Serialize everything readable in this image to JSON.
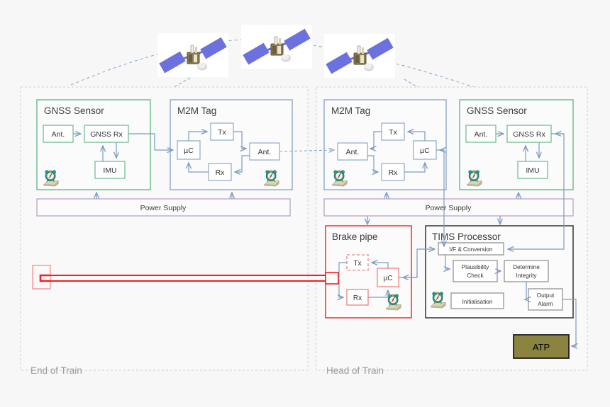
{
  "diagram": {
    "title": "Train Integrity Monitoring System (TIMS) architecture",
    "colors": {
      "background": "#f7f7f7",
      "container_border": "#cccccc",
      "gnss_green": "#66bb8a",
      "m2m_blue": "#8fa9c9",
      "power_purple": "#b49cc4",
      "brake_red": "#f22020",
      "tims_black": "#333333",
      "atp_olive": "#8b8340",
      "arrow_blue": "#7d9bc1",
      "dashed_link": "#8fa9c9",
      "text_dark": "#404040",
      "text_muted": "#9a9a9a"
    },
    "sections": [
      {
        "id": "eot",
        "label": "End of Train"
      },
      {
        "id": "hot",
        "label": "Head of Train"
      }
    ],
    "satellites": [
      {
        "id": "sat-1",
        "name": "gnss-satellite-icon"
      },
      {
        "id": "sat-2",
        "name": "gnss-satellite-icon"
      },
      {
        "id": "sat-3",
        "name": "gnss-satellite-icon"
      }
    ],
    "eot": {
      "gnss_sensor": {
        "title": "GNSS Sensor",
        "blocks": [
          {
            "id": "ant",
            "label": "Ant."
          },
          {
            "id": "gnss_rx",
            "label": "GNSS Rx"
          },
          {
            "id": "imu",
            "label": "IMU"
          }
        ],
        "clock_icon": "alarm-clock-icon"
      },
      "m2m_tag": {
        "title": "M2M Tag",
        "blocks": [
          {
            "id": "uc",
            "label": "µC"
          },
          {
            "id": "tx",
            "label": "Tx"
          },
          {
            "id": "rx",
            "label": "Rx"
          },
          {
            "id": "ant",
            "label": "Ant."
          }
        ],
        "clock_icon": "alarm-clock-icon"
      },
      "power_supply": {
        "label": "Power Supply"
      },
      "brake_pipe_terminus": {
        "label": ""
      }
    },
    "hot": {
      "m2m_tag": {
        "title": "M2M Tag",
        "blocks": [
          {
            "id": "ant",
            "label": "Ant."
          },
          {
            "id": "tx",
            "label": "Tx"
          },
          {
            "id": "rx",
            "label": "Rx"
          },
          {
            "id": "uc",
            "label": "µC"
          }
        ],
        "clock_icon": "alarm-clock-icon"
      },
      "gnss_sensor": {
        "title": "GNSS Sensor",
        "blocks": [
          {
            "id": "ant",
            "label": "Ant."
          },
          {
            "id": "gnss_rx",
            "label": "GNSS Rx"
          },
          {
            "id": "imu",
            "label": "IMU"
          }
        ],
        "clock_icon": "alarm-clock-icon"
      },
      "power_supply": {
        "label": "Power Supply"
      },
      "brake_pipe": {
        "title": "Brake pipe",
        "blocks": [
          {
            "id": "tx",
            "label": "Tx"
          },
          {
            "id": "rx",
            "label": "Rx"
          },
          {
            "id": "uc",
            "label": "µC"
          }
        ],
        "clock_icon": "alarm-clock-icon"
      },
      "tims_processor": {
        "title": "TIMS Processor",
        "blocks": [
          {
            "id": "if_conv",
            "label": "I/F & Conversion"
          },
          {
            "id": "plausibility",
            "label": "Plausibility Check"
          },
          {
            "id": "integrity",
            "label": "Determine Integrity"
          },
          {
            "id": "initialisation",
            "label": "Initialisation"
          },
          {
            "id": "output_alarm",
            "label": "Output Alarm"
          }
        ],
        "clock_icon": "alarm-clock-icon"
      },
      "atp": {
        "label": "ATP"
      }
    }
  }
}
